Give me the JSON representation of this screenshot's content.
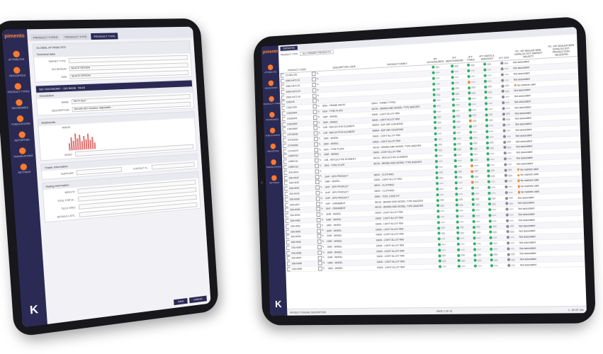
{
  "left_tablet": {
    "brand": "pimento",
    "tabs": [
      "PRODUCT TYPES",
      "PRODUCT TYPE",
      "PRODUCT TYPE"
    ],
    "sidebar": [
      "ATTRIBUTES",
      "RESOURCES",
      "PRODUCT TYPES",
      "TAXONOMIES",
      "PUBLICATIONS",
      "REPORTING",
      "TRANSLATIONS",
      "SETTINGS"
    ],
    "global_attributes": "GLOBAL ATTRIBUTES",
    "technical_data": "Technical data",
    "fields": [
      {
        "key": "TARGET TYPE",
        "value": ""
      },
      {
        "key": "SKI DESIGN",
        "value": "BLACK DESIGN"
      },
      {
        "key": "SIZE",
        "value": "BLACK DESIGN"
      }
    ],
    "sub_tab_active": "SKI TAXONOMY - SKI BASE",
    "sub_tab_other": "TAGS",
    "description": "Description",
    "name_key": "NAME",
    "name_val": "Ski Fr 6oo+",
    "desc_key": "DESCRIPTION",
    "desc_val": "Ski with ISO modules. Adjustable...",
    "multimedia": "Multimedia",
    "image_key": "IMAGE",
    "video_key": "VIDEO",
    "trader_info": "Trader information",
    "supplier_key": "SUPPLIER",
    "contact_key": "CONTACT N...",
    "rating": "Rating information",
    "rating_fields": [
      "WEIGTH",
      "TOOL FOR M...",
      "TECH SPEC",
      "DETAILS LATE..."
    ],
    "chart_heights": [
      0.4,
      0.7,
      0.5,
      0.9,
      0.6,
      0.8,
      0.45,
      0.75,
      0.55,
      0.85,
      0.5,
      0.65,
      0.35
    ],
    "buttons": [
      "SAVE",
      "CANCEL"
    ]
  },
  "right_tablet": {
    "brand": "pimento",
    "topbar_tab": "DATAGRID",
    "filter_label": "PRODUCT TYPE",
    "filter_value": "ALL PRIMARY PRODUCTS",
    "sidebar": [
      "ATTRIBUTES",
      "RESOURCES",
      "PRODUCT TYPES",
      "TAXONOMIES",
      "PUBLICATIONS",
      "REPORTING",
      "TRANSLATIONS",
      "SETTINGS"
    ],
    "columns": [
      "",
      "PRODUCT CODE",
      "",
      "DESCRIPTION CODE",
      "PRODUCT FAMILY",
      "IPT: ACCESSORIES",
      "IPT: MERCHANDISE",
      "IPT: TYRES",
      "IPT: PARTS & SERVICES",
      "IPT: DFS",
      "PC: VIP DEALER WEB CATALOG EXT. MARKET VALIDITY",
      "PC: VIP DEALER WEB CATALOG EXT. PRODUCTION: VALIDATED"
    ],
    "rows": [
      {
        "code": "271451.001",
        "desc": "",
        "family": "",
        "s": [
          "g",
          "g",
          "g",
          "g",
          "n"
        ],
        "market": "Not associated",
        "m": ""
      },
      {
        "code": "2060-H472-01",
        "desc": "",
        "family": "",
        "s": [
          "g",
          "g",
          "g",
          "g",
          "n"
        ],
        "market": "Not associated",
        "m": ""
      },
      {
        "code": "2060-H472-02",
        "desc": "",
        "family": "",
        "s": [
          "g",
          "g",
          "g",
          "g",
          "n"
        ],
        "market": "Not associated",
        "m": ""
      },
      {
        "code": "2060-H472-03",
        "desc": "",
        "family": "",
        "s": [
          "g",
          "g",
          "o",
          "g",
          "n"
        ],
        "market": "Not associated",
        "m": ""
      },
      {
        "code": "2060-H472-04",
        "desc": "",
        "family": "",
        "s": [
          "g",
          "g",
          "g",
          "g",
          "n"
        ],
        "market": "No markets valid",
        "m": "o"
      },
      {
        "code": "C061H0",
        "desc": "",
        "family": "",
        "s": [
          "g",
          "g",
          "g",
          "g",
          "n"
        ],
        "market": "Not associated",
        "m": ""
      },
      {
        "code": "C0617209",
        "desc": "GNH - FRAME WHITE",
        "family": "DA00 - TURBO TYPES",
        "s": [
          "g",
          "g",
          "g",
          "g",
          "n"
        ],
        "market": "Not associated",
        "m": ""
      },
      {
        "code": "C0619044",
        "desc": "GEA - TYRE PLATE",
        "family": "WC00 - BRAND AND MODEL TYPE BADGES",
        "s": [
          "g",
          "g",
          "g",
          "g",
          "n"
        ],
        "market": "Not associated",
        "m": ""
      },
      {
        "code": "C0616349",
        "desc": "GNR - WHEEL",
        "family": "DA06 - LIGHT ALLOY RIM",
        "s": [
          "g",
          "g",
          "g",
          "g",
          "n"
        ],
        "market": "Not associated",
        "m": ""
      },
      {
        "code": "C0616350",
        "desc": "GNR - WHEEL",
        "family": "DA06 - LIGHT ALLOY RIM",
        "s": [
          "g",
          "g",
          "g",
          "g",
          "n"
        ],
        "market": "Not associated",
        "m": ""
      },
      {
        "code": "C0616460",
        "desc": "LVB - REFLECTIVE ELEMENT",
        "family": "WM04 - EDF AIR CUSHIONS",
        "s": [
          "g",
          "g",
          "o",
          "g",
          "n"
        ],
        "market": "Not associated",
        "m": ""
      },
      {
        "code": "C0T40040",
        "desc": "LVB - REFLECTIVE ELEMENT",
        "family": "WM04 - EDF AIR CUSHIONS",
        "s": [
          "g",
          "g",
          "g",
          "g",
          "n"
        ],
        "market": "Not associated",
        "m": ""
      },
      {
        "code": "C0T40050",
        "desc": "GNR - WHEEL",
        "family": "DA06 - LIGHT ALLOY RIM",
        "s": [
          "g",
          "g",
          "g",
          "g",
          "n"
        ],
        "market": "Not associated",
        "m": ""
      },
      {
        "code": "C0T40060",
        "desc": "GNR - WHEEL",
        "family": "DA06 - LIGHT ALLOY RIM",
        "s": [
          "g",
          "g",
          "g",
          "g",
          "n"
        ],
        "market": "Not associated",
        "m": ""
      },
      {
        "code": "C0T40070",
        "desc": "GEA - TYRE PLATE",
        "family": "WC00 - BRAND AND MODEL TYPE BADGES",
        "s": [
          "g",
          "g",
          "g",
          "g",
          "n"
        ],
        "market": "Not associated",
        "m": ""
      },
      {
        "code": "L06E0110",
        "desc": "GNR - WHEEL",
        "family": "DA06 - LIGHT ALLOY RIM",
        "s": [
          "g",
          "g",
          "g",
          "g",
          "n"
        ],
        "market": "Not associated",
        "m": ""
      },
      {
        "code": "L06E0111",
        "desc": "LVB - REFLECTIVE ELEMENT",
        "family": "WC04 - REFLECTIVE ELEMENT",
        "s": [
          "g",
          "g",
          "g",
          "g",
          "n"
        ],
        "market": "Not associated",
        "m": ""
      },
      {
        "code": "L06E0112",
        "desc": "GEA - TYRE PLATE",
        "family": "WC00 - BRAND AND MODEL TYPE BADGES",
        "s": [
          "g",
          "g",
          "g",
          "g",
          "n"
        ],
        "market": "Not associated",
        "m": ""
      },
      {
        "code": "Z06-H041",
        "desc": "",
        "family": "",
        "s": [
          "g",
          "g",
          "o",
          "g",
          "n"
        ],
        "market": "Not associated",
        "m": ""
      },
      {
        "code": "Z06-H042",
        "desc": "GHP - DPS PRODUCT",
        "family": "NE00 - CLOTHING",
        "s": [
          "g",
          "g",
          "o",
          "g",
          "n"
        ],
        "market": "No markets valid",
        "m": "o"
      },
      {
        "code": "Z06-H043",
        "desc": "GNR - WHEEL",
        "family": "DA06 - LIGHT ALLOY RIM",
        "s": [
          "g",
          "g",
          "g",
          "g",
          "n"
        ],
        "market": "No markets valid",
        "m": "o"
      },
      {
        "code": "Z06-H044",
        "desc": "GHP - DPS PRODUCT",
        "family": "NE00 - CLOTHING",
        "s": [
          "g",
          "g",
          "o",
          "g",
          "n"
        ],
        "market": "No markets valid",
        "m": "o"
      },
      {
        "code": "Z06-H045",
        "desc": "GHP - DPS PRODUCT",
        "family": "NE00 - CLOTHING",
        "s": [
          "g",
          "g",
          "g",
          "g",
          "n"
        ],
        "market": "No markets valid",
        "m": "o"
      },
      {
        "code": "Z06-H046",
        "desc": "GHP - DPS PRODUCT",
        "family": "ZB00 - TOOL CASE KIT",
        "s": [
          "g",
          "g",
          "g",
          "g",
          "n"
        ],
        "market": "No markets valid",
        "m": "o"
      },
      {
        "code": "Z06-H047",
        "desc": "GHF - ORNAMENT",
        "family": "WC00 - BRAND AND MODEL TYPE BADGES",
        "s": [
          "g",
          "g",
          "g",
          "g",
          "n"
        ],
        "market": "Not associated",
        "m": ""
      },
      {
        "code": "Z06-H048",
        "desc": "GHF - ORNAMENT",
        "family": "WC00 - BRAND AND MODEL TYPE BADGES",
        "s": [
          "g",
          "g",
          "g",
          "g",
          "n"
        ],
        "market": "Not associated",
        "m": ""
      },
      {
        "code": "Z06-H049",
        "desc": "GNR - WHEEL",
        "family": "DA06 - LIGHT ALLOY RIM",
        "s": [
          "g",
          "g",
          "g",
          "g",
          "n"
        ],
        "market": "Not associated",
        "m": ""
      },
      {
        "code": "Z06-H050",
        "desc": "GNR - WHEEL",
        "family": "DA06 - LIGHT ALLOY RIM",
        "s": [
          "g",
          "g",
          "g",
          "g",
          "n"
        ],
        "market": "Not associated",
        "m": ""
      },
      {
        "code": "Z06-H051",
        "desc": "GNR - WHEEL",
        "family": "DA06 - LIGHT ALLOY RIM",
        "s": [
          "g",
          "g",
          "g",
          "g",
          "n"
        ],
        "market": "Not associated",
        "m": ""
      },
      {
        "code": "Z06-H052",
        "desc": "GNR - WHEEL",
        "family": "DA06 - LIGHT ALLOY RIM",
        "s": [
          "g",
          "g",
          "g",
          "g",
          "n"
        ],
        "market": "Not associated",
        "m": ""
      },
      {
        "code": "Z06-H053",
        "desc": "GNR - WHEEL",
        "family": "DA06 - LIGHT ALLOY RIM",
        "s": [
          "g",
          "g",
          "g",
          "g",
          "n"
        ],
        "market": "Not associated",
        "m": ""
      },
      {
        "code": "Z06-H054",
        "desc": "GNR - WHEEL",
        "family": "DA06 - LIGHT ALLOY RIM",
        "s": [
          "g",
          "g",
          "g",
          "g",
          "n"
        ],
        "market": "Not associated",
        "m": ""
      },
      {
        "code": "Z06-H055",
        "desc": "GNR - WHEEL",
        "family": "DA06 - LIGHT ALLOY RIM",
        "s": [
          "g",
          "g",
          "g",
          "g",
          "n"
        ],
        "market": "Not associated",
        "m": ""
      },
      {
        "code": "Z06-H056",
        "desc": "GNR - WHEEL",
        "family": "DA06 - LIGHT ALLOY RIM",
        "s": [
          "g",
          "g",
          "g",
          "g",
          "n"
        ],
        "market": "Not associated",
        "m": ""
      },
      {
        "code": "Z06-H057",
        "desc": "GNR - WHEEL",
        "family": "DA06 - LIGHT ALLOY RIM",
        "s": [
          "g",
          "g",
          "g",
          "g",
          "n"
        ],
        "market": "Not associated",
        "m": ""
      },
      {
        "code": "Z06-H058",
        "desc": "GNR - WHEEL",
        "family": "DA06 - LIGHT ALLOY RIM",
        "s": [
          "g",
          "g",
          "g",
          "g",
          "n"
        ],
        "market": "Not associated",
        "m": ""
      },
      {
        "code": "Z06-H059",
        "desc": "GNR - WHEEL",
        "family": "DA06 - LIGHT ALLOY RIM",
        "s": [
          "g",
          "g",
          "g",
          "g",
          "n"
        ],
        "market": "Not associated",
        "m": ""
      }
    ],
    "pager_left": "PRODUCT ENGINE DESCRIPTION",
    "pager_page": "PAGE 1",
    "pager_of": "OF 10",
    "pager_count": "1 - 50 OF 324"
  },
  "colors": {
    "sidebar": "#2b2a55",
    "accent": "#ff7a2e",
    "green": "#2fae6a",
    "orange": "#ee8a3a"
  }
}
